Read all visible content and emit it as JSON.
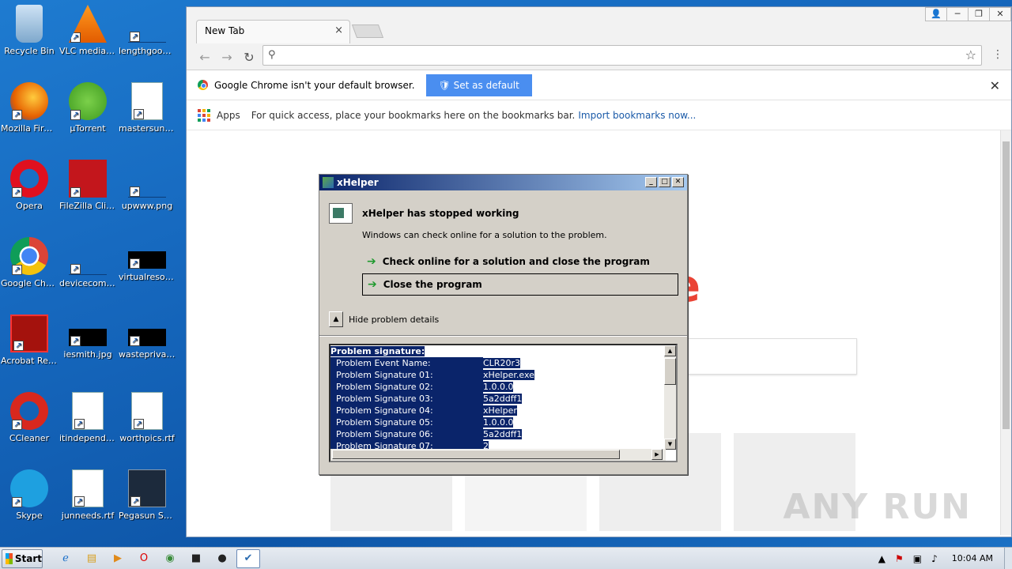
{
  "desktop": {
    "icons": [
      {
        "label": "Recycle Bin",
        "icon": "recycle-bin-icon"
      },
      {
        "label": "VLC media player",
        "icon": "vlc-icon"
      },
      {
        "label": "lengthgood...",
        "icon": "file-icon"
      },
      {
        "label": "Mozilla Firefox",
        "icon": "firefox-icon"
      },
      {
        "label": "µTorrent",
        "icon": "utorrent-icon"
      },
      {
        "label": "mastersun.rtf",
        "icon": "word-doc-icon"
      },
      {
        "label": "Opera",
        "icon": "opera-icon"
      },
      {
        "label": "FileZilla Client",
        "icon": "filezilla-icon"
      },
      {
        "label": "upwww.png",
        "icon": "image-icon"
      },
      {
        "label": "Google Chrome",
        "icon": "chrome-icon"
      },
      {
        "label": "devicecomp...",
        "icon": "file-icon"
      },
      {
        "label": "virtualresolu...",
        "icon": "black-thumb-icon"
      },
      {
        "label": "Acrobat Reader DC",
        "icon": "acrobat-icon"
      },
      {
        "label": "iesmith.jpg",
        "icon": "black-thumb-icon"
      },
      {
        "label": "wasteprivac...",
        "icon": "black-thumb-icon"
      },
      {
        "label": "CCleaner",
        "icon": "ccleaner-icon"
      },
      {
        "label": "itindepende...",
        "icon": "word-doc-icon"
      },
      {
        "label": "worthpics.rtf",
        "icon": "word-doc-icon"
      },
      {
        "label": "Skype",
        "icon": "skype-icon"
      },
      {
        "label": "junneeds.rtf",
        "icon": "word-doc-icon"
      },
      {
        "label": "Pegasun Syste...",
        "icon": "pegasun-icon"
      }
    ]
  },
  "chrome": {
    "tab_title": "New Tab",
    "tab_close": "×",
    "omnibox_value": "",
    "infobar_text": "Google Chrome isn't your default browser.",
    "set_default_label": "Set as default",
    "bookmarks": {
      "apps_label": "Apps",
      "hint": "For quick access, place your bookmarks here on the bookmarks bar.",
      "import_link": "Import bookmarks now..."
    },
    "google_fragment": "e",
    "watermark": "ANY RUN"
  },
  "dialog": {
    "title": "xHelper",
    "heading": "xHelper has stopped working",
    "subtext": "Windows can check online for a solution to the problem.",
    "option_check": "Check online for a solution and close the program",
    "option_close": "Close the program",
    "toggle_details": "Hide problem details",
    "details_header": "Problem signature:",
    "details": [
      {
        "key": "Problem Event Name:",
        "value": "CLR20r3"
      },
      {
        "key": "Problem Signature 01:",
        "value": "xHelper.exe"
      },
      {
        "key": "Problem Signature 02:",
        "value": "1.0.0.0"
      },
      {
        "key": "Problem Signature 03:",
        "value": "5a2ddff1"
      },
      {
        "key": "Problem Signature 04:",
        "value": "xHelper"
      },
      {
        "key": "Problem Signature 05:",
        "value": "1.0.0.0"
      },
      {
        "key": "Problem Signature 06:",
        "value": "5a2ddff1"
      },
      {
        "key": "Problem Signature 07:",
        "value": "2"
      }
    ]
  },
  "taskbar": {
    "start_label": "Start",
    "clock": "10:04 AM"
  },
  "colors": {
    "dialog_title_start": "#0a246a",
    "dialog_title_end": "#a6caf0",
    "selection": "#0a246a",
    "set_default_button": "#4a8ef0"
  }
}
